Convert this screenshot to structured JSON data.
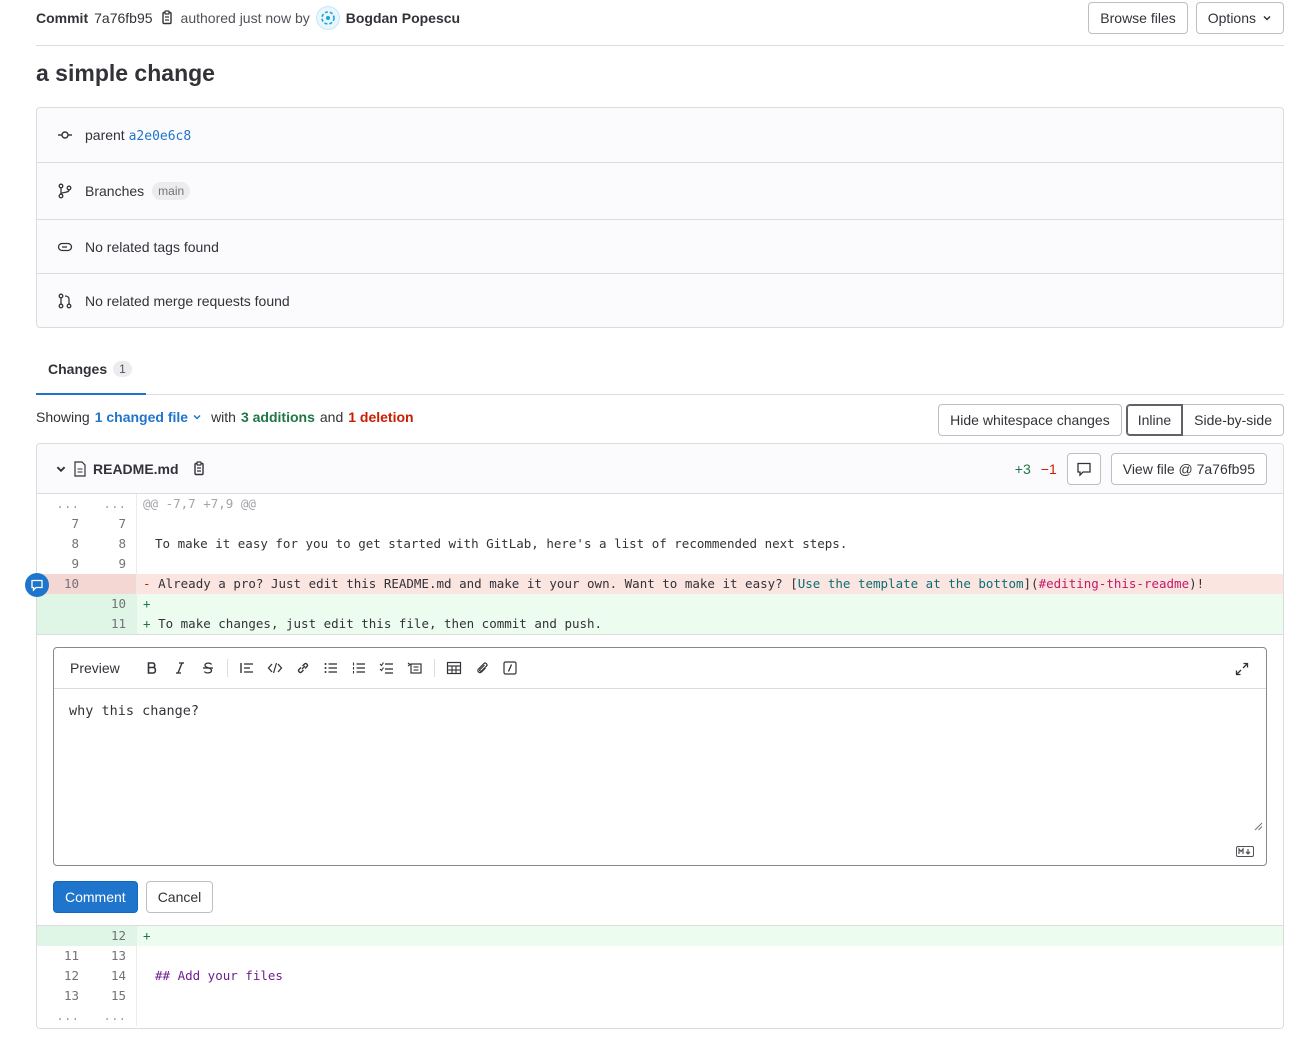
{
  "header": {
    "commit_label": "Commit",
    "sha": "7a76fb95",
    "authored_text": "authored just now by",
    "author": "Bogdan Popescu",
    "browse_files": "Browse files",
    "options": "Options"
  },
  "commit_title": "a simple change",
  "info": {
    "parent_label": "parent",
    "parent_sha": "a2e0e6c8",
    "branches_label": "Branches",
    "branch": "main",
    "tags_text": "No related tags found",
    "mr_text": "No related merge requests found"
  },
  "tabs": {
    "changes_label": "Changes",
    "changes_count": "1"
  },
  "stats": {
    "showing": "Showing",
    "changed_files": "1 changed file",
    "with": "with",
    "additions": "3 additions",
    "and": "and",
    "deletions": "1 deletion",
    "hide_whitespace": "Hide whitespace changes",
    "inline": "Inline",
    "side_by_side": "Side-by-side"
  },
  "file": {
    "name": "README.md",
    "additions": "+3",
    "deletions": "−1",
    "view_file": "View file @ 7a76fb95"
  },
  "diff_top": [
    {
      "type": "meta",
      "old": "...",
      "new": "...",
      "text": "@@ -7,7 +7,9 @@"
    },
    {
      "type": "ctx",
      "old": "7",
      "new": "7",
      "text": ""
    },
    {
      "type": "ctx",
      "old": "8",
      "new": "8",
      "text": "To make it easy for you to get started with GitLab, here's a list of recommended next steps."
    },
    {
      "type": "ctx",
      "old": "9",
      "new": "9",
      "text": ""
    },
    {
      "type": "del",
      "old": "10",
      "new": "",
      "text_a": "Already a pro? Just edit this README.md and make it your own. Want to make it easy? [",
      "text_b": "Use the template at the bottom",
      "text_c": "](",
      "text_d": "#editing-this-readme",
      "text_e": ")!"
    },
    {
      "type": "add",
      "old": "",
      "new": "10",
      "text": ""
    },
    {
      "type": "add",
      "old": "",
      "new": "11",
      "text": "To make changes, just edit this file, then commit and push."
    }
  ],
  "comment": {
    "preview": "Preview",
    "text": "why this change?",
    "submit": "Comment",
    "cancel": "Cancel"
  },
  "diff_bottom": [
    {
      "type": "add",
      "old": "",
      "new": "12",
      "text": ""
    },
    {
      "type": "ctx",
      "old": "11",
      "new": "13",
      "text": ""
    },
    {
      "type": "ctx",
      "old": "12",
      "new": "14",
      "text": "## Add your files"
    },
    {
      "type": "ctx",
      "old": "13",
      "new": "15",
      "text": ""
    },
    {
      "type": "meta",
      "old": "...",
      "new": "...",
      "text": ""
    }
  ]
}
